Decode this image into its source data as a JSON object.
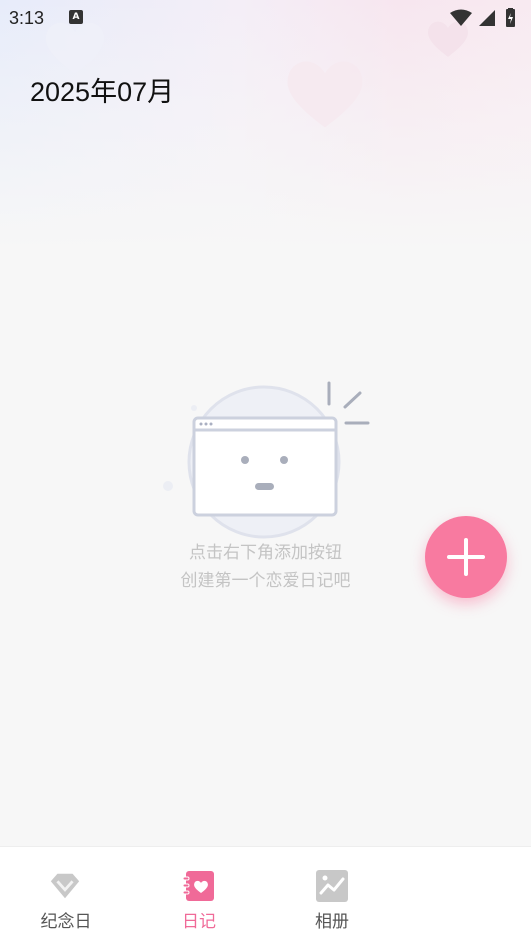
{
  "status_bar": {
    "time": "3:13",
    "notification_icon": "a-icon",
    "icons": [
      "wifi-icon",
      "signal-icon",
      "battery-icon"
    ]
  },
  "header": {
    "month": "2025年07月"
  },
  "empty_state": {
    "line1": "点击右下角添加按钮",
    "line2": "创建第一个恋爱日记吧",
    "icon": "empty-browser-face-icon"
  },
  "fab": {
    "icon": "plus-icon",
    "color": "#f87aa0"
  },
  "bottom_nav": {
    "items": [
      {
        "label": "纪念日",
        "icon": "diamond-icon",
        "active": false
      },
      {
        "label": "日记",
        "icon": "diary-heart-icon",
        "active": true
      },
      {
        "label": "相册",
        "icon": "photo-icon",
        "active": false
      }
    ],
    "active_color": "#f06a98",
    "inactive_color": "#555555"
  }
}
